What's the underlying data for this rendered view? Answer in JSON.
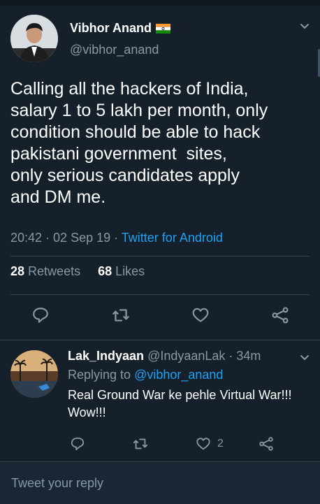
{
  "main_tweet": {
    "display_name": "Vibhor Anand",
    "handle": "@vibhor_anand",
    "text": "Calling all the hackers of India,\nsalary 1 to 5 lakh per month, only\ncondition should be able to hack\npakistani government  sites,\nonly serious candidates apply\nand DM me.",
    "time_date": "20:42 · 02 Sep 19 · ",
    "client": "Twitter for Android",
    "retweets_count": "28",
    "retweets_label": "Retweets",
    "likes_count": "68",
    "likes_label": "Likes",
    "icons": [
      "reply-icon",
      "retweet-icon",
      "like-icon",
      "share-icon",
      "chevron-down-icon",
      "india-flag-icon"
    ]
  },
  "reply": {
    "display_name": "Lak_Indyaan",
    "handle_time": "@IndyaanLak · 34m",
    "replying_prefix": "Replying to ",
    "replying_to": "@vibhor_anand",
    "text": "Real Ground War ke pehle Virtual War!!! Wow!!!",
    "like_count": "2"
  },
  "composer": {
    "placeholder": "Tweet your reply"
  },
  "colors": {
    "background": "#15202b",
    "accent": "#1da1f2",
    "secondary_text": "#8899a6",
    "divider": "#38444d"
  }
}
